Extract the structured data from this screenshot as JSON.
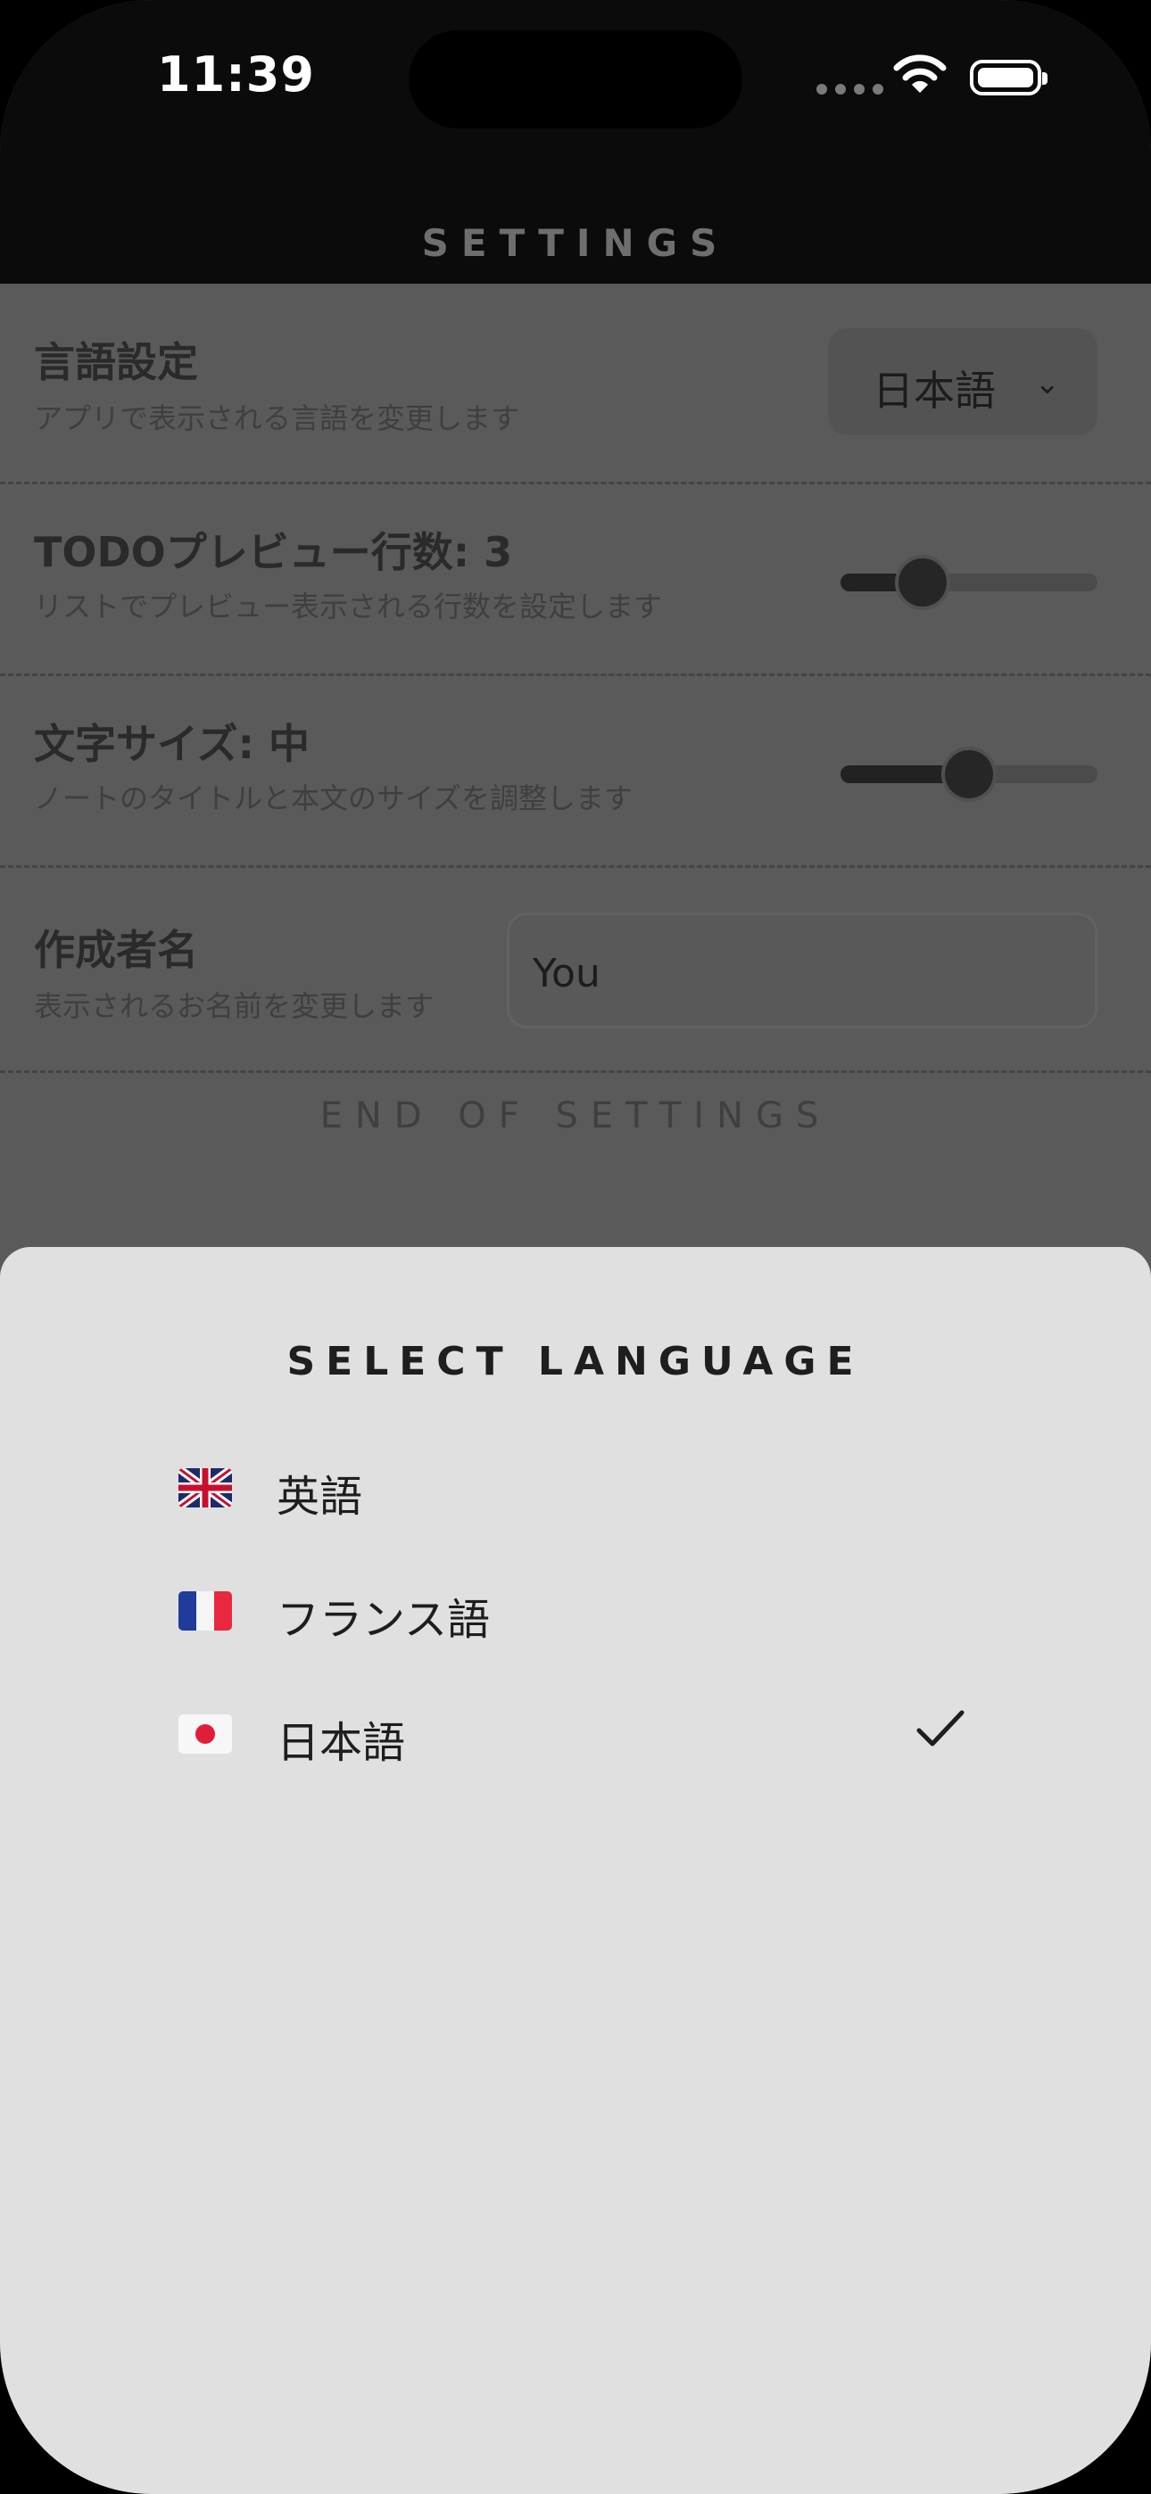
{
  "status_bar": {
    "time": "11:39"
  },
  "header": {
    "title": "SETTINGS"
  },
  "settings": {
    "language": {
      "title": "言語設定",
      "description": "アプリで表示される言語を変更します",
      "value": "日本語"
    },
    "preview_lines": {
      "title": "TODOプレビュー行数: 3",
      "description": "リストでプレビュー表示される行数を設定します",
      "level": 0.27
    },
    "font_size": {
      "title": "文字サイズ: 中",
      "description": "ノートのタイトルと本文のサイズを調整します",
      "level": 0.5
    },
    "author": {
      "title": "作成者名",
      "description": "表示されるお名前を変更します",
      "value": "You"
    },
    "end_text": "END OF SETTINGS"
  },
  "language_sheet": {
    "title": "SELECT LANGUAGE",
    "options": [
      {
        "label": "英語",
        "flag": "uk-flag-icon",
        "selected": false
      },
      {
        "label": "フランス語",
        "flag": "france-flag-icon",
        "selected": false
      },
      {
        "label": "日本語",
        "flag": "japan-flag-icon",
        "selected": true
      }
    ]
  },
  "colors": {
    "sheet_bg": "#e0e0e0",
    "overlay": "#5a5a5a",
    "header_bg": "#0b0b0b"
  }
}
